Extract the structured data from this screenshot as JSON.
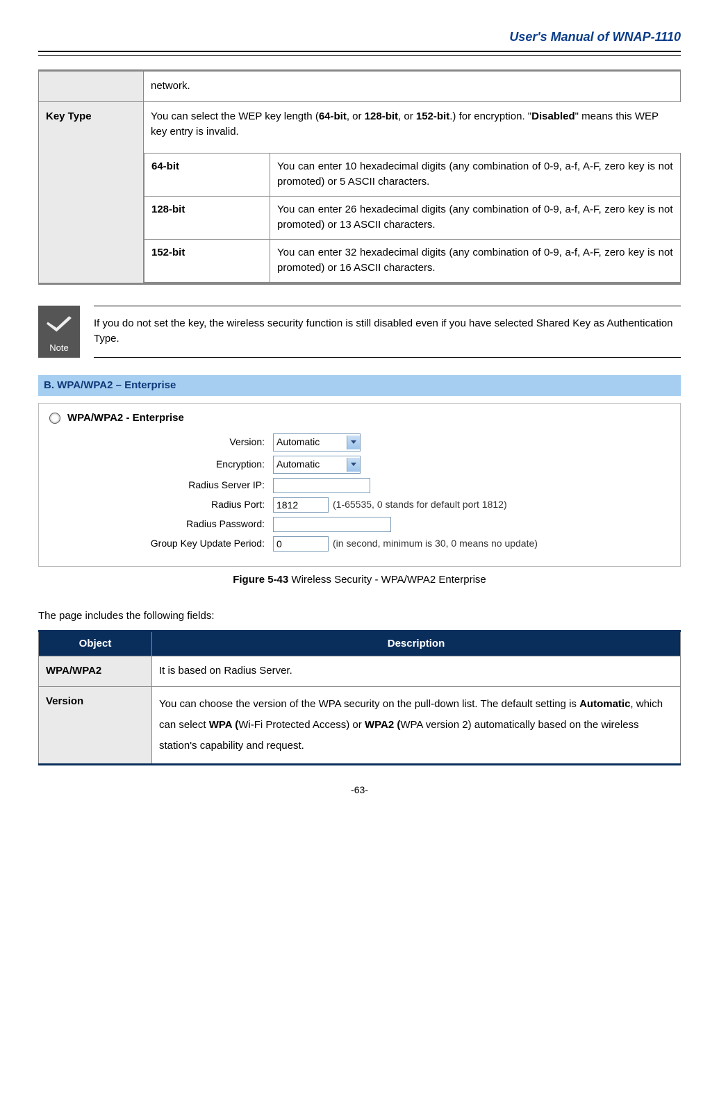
{
  "header": {
    "title": "User's Manual of WNAP-1110"
  },
  "key_table": {
    "row0_desc": "network.",
    "label": "Key Type",
    "intro_pre": "You can select the WEP key length (",
    "b64": "64-bit",
    "sep1": ", or ",
    "b128": "128-bit",
    "sep2": ", or ",
    "b152": "152-bit",
    "intro_post": ".) for encryption. \"",
    "disabled": "Disabled",
    "intro_end": "\" means this WEP key entry is invalid.",
    "rows": [
      {
        "k": "64-bit",
        "v": "You can enter 10 hexadecimal digits (any combination of 0-9, a-f, A-F, zero key is not promoted) or 5 ASCII characters."
      },
      {
        "k": "128-bit",
        "v": "You can enter 26 hexadecimal digits (any combination of 0-9, a-f, A-F, zero key is not promoted) or 13 ASCII characters."
      },
      {
        "k": "152-bit",
        "v": "You can enter 32 hexadecimal digits (any combination of 0-9, a-f, A-F, zero key is not promoted) or 16 ASCII characters."
      }
    ]
  },
  "note": {
    "label": "Note",
    "text": "If you do not set the key, the wireless security function is still disabled even if you have selected Shared Key as Authentication Type."
  },
  "section": {
    "heading": "B.    WPA/WPA2 – Enterprise"
  },
  "figure": {
    "radio_label": "WPA/WPA2 - Enterprise",
    "version_label": "Version:",
    "version_value": "Automatic",
    "encryption_label": "Encryption:",
    "encryption_value": "Automatic",
    "radius_ip_label": "Radius Server IP:",
    "radius_ip_value": "",
    "radius_port_label": "Radius Port:",
    "radius_port_value": "1812",
    "radius_port_hint": "(1-65535, 0 stands for default port 1812)",
    "radius_pw_label": "Radius Password:",
    "radius_pw_value": "",
    "group_label": "Group Key Update Period:",
    "group_value": "0",
    "group_hint": "(in second, minimum is 30, 0 means no update)",
    "caption_bold": "Figure 5-43",
    "caption_text": "    Wireless Security - WPA/WPA2 Enterprise"
  },
  "fields_intro": "The page includes the following fields:",
  "fields_table": {
    "h_object": "Object",
    "h_desc": "Description",
    "r1_label": "WPA/WPA2",
    "r1_desc": "It is based on Radius Server.",
    "r2_label": "Version",
    "r2_pre": "You can choose the version of the WPA security on the pull-down list. The default setting is ",
    "r2_b1": "Automatic",
    "r2_mid1": ", which can select ",
    "r2_b2": "WPA (",
    "r2_mid2": "Wi-Fi Protected Access) or ",
    "r2_b3": "WPA2 (",
    "r2_mid3": "WPA version 2) automatically based on the wireless station's capability and request."
  },
  "page_number": "-63-"
}
